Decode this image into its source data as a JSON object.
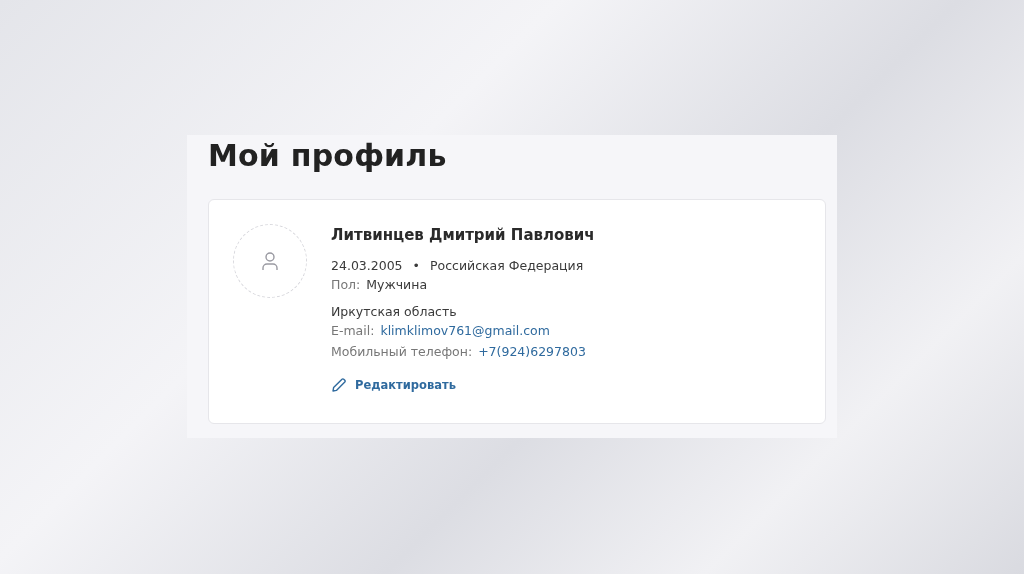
{
  "page_title": "Мой профиль",
  "profile": {
    "full_name": "Литвинцев Дмитрий Павлович",
    "birth_date": "24.03.2005",
    "separator": "•",
    "country": "Российская Федерация",
    "gender": {
      "label": "Пол:",
      "value": "Мужчина"
    },
    "region": "Иркутская область",
    "email": {
      "label": "E-mail:",
      "value": "klimklimov761@gmail.com"
    },
    "phone": {
      "label": "Мобильный телефон:",
      "value": "+7(924)6297803"
    },
    "edit_link": "Редактировать"
  }
}
